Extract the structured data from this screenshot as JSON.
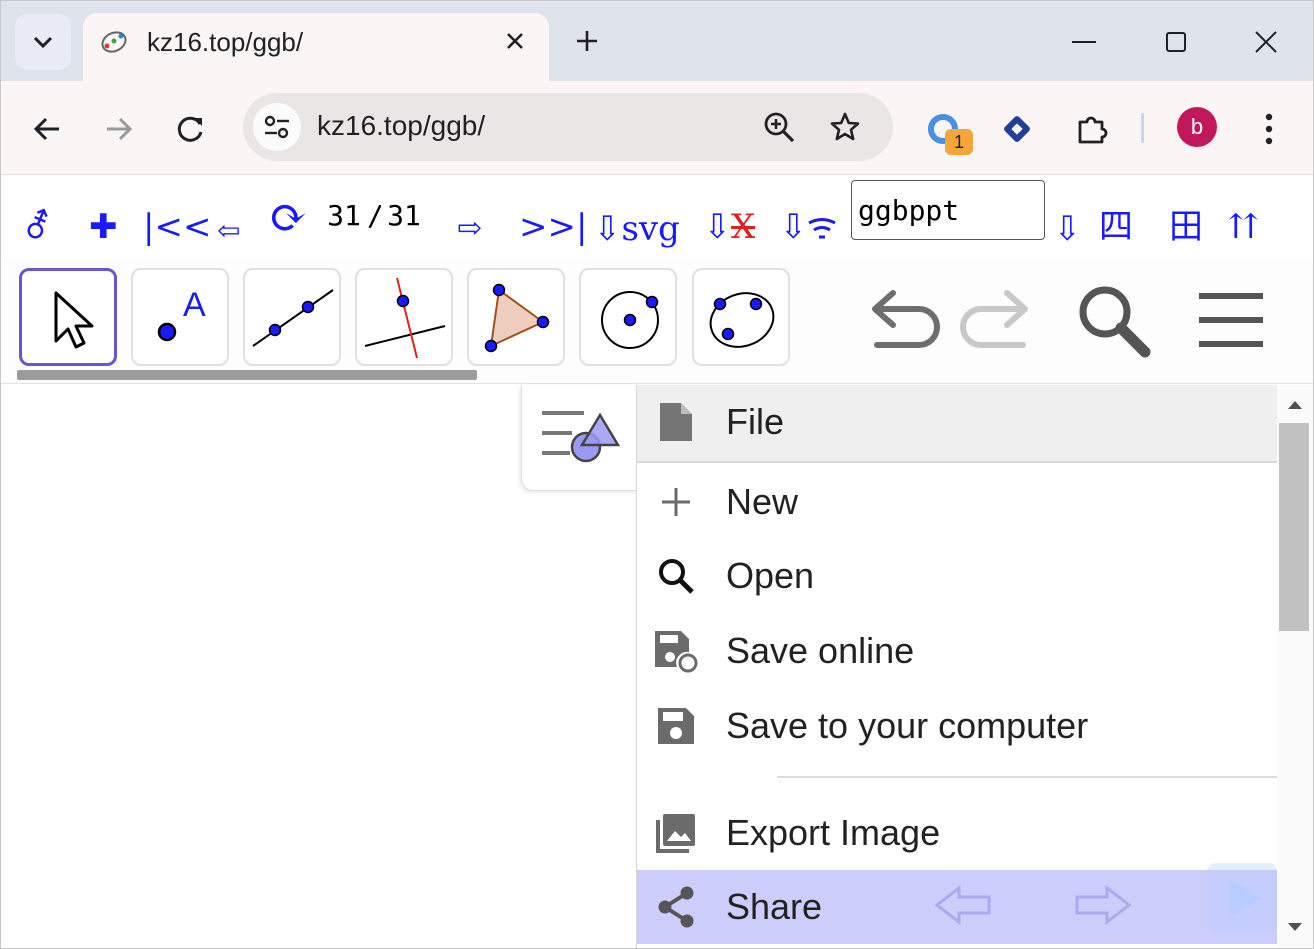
{
  "browser": {
    "tab_title": "kz16.top/ggb/",
    "url": "kz16.top/ggb/",
    "extension_badge": "1",
    "profile_initial": "b"
  },
  "ggb_links": {
    "gender": "⚦",
    "add": "✚",
    "first": "|<<",
    "prev": "⇦",
    "refresh": "⟳",
    "current": "31",
    "slash": "/",
    "total": "31",
    "next": "⇨",
    "last": ">>|",
    "svg": "⇩svg",
    "down1": "⇩",
    "x_mark": "X",
    "down2": "⇩",
    "download": "⇩",
    "four": "四",
    "field": "田",
    "up": "⇈",
    "input_value": "ggbppt"
  },
  "menu": {
    "file": "File",
    "new": "New",
    "open": "Open",
    "save_online": "Save online",
    "save_computer": "Save to your computer",
    "export_image": "Export Image",
    "share": "Share"
  },
  "tools": {
    "point_letter": "A"
  },
  "colors": {
    "link": "#1a1aff",
    "tool_selected": "#6557d2",
    "share_highlight": "#cdcdfb",
    "avatar": "#c2185b",
    "badge": "#f2a63b"
  }
}
